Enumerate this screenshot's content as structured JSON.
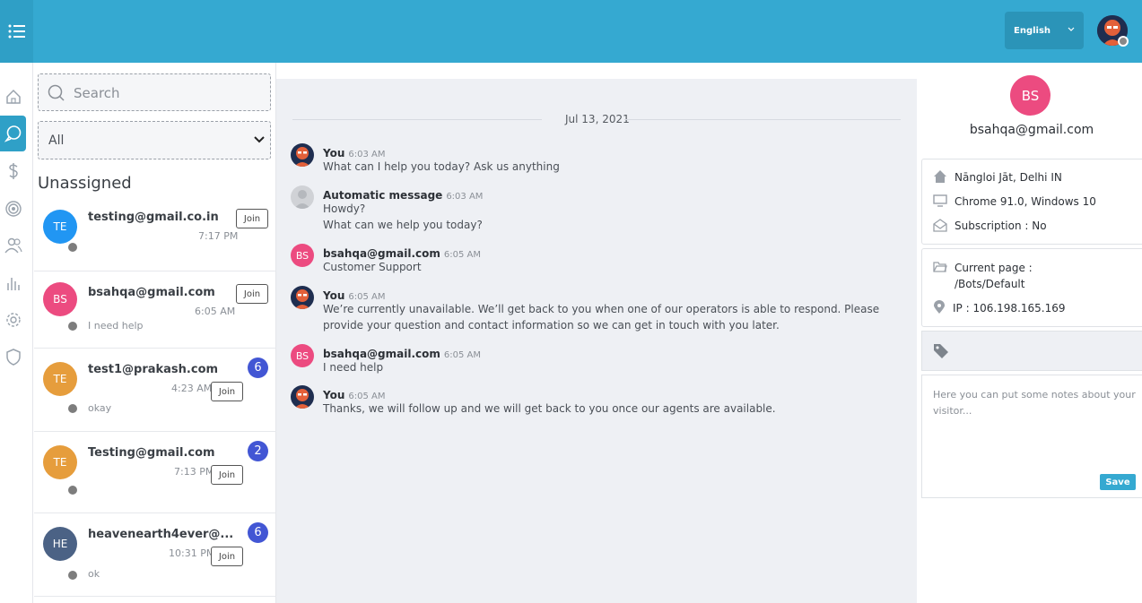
{
  "header": {
    "language": "English",
    "colors": {
      "brand": "#35a9d1",
      "accent_dark": "#2b94b8"
    }
  },
  "nav": {
    "items": [
      {
        "icon": "home-icon",
        "active": false
      },
      {
        "icon": "chat-bubble-icon",
        "active": true
      },
      {
        "icon": "dollar-icon",
        "active": false
      },
      {
        "icon": "target-icon",
        "active": false
      },
      {
        "icon": "users-icon",
        "active": false
      },
      {
        "icon": "bar-chart-icon",
        "active": false
      },
      {
        "icon": "gear-icon",
        "active": false
      },
      {
        "icon": "shield-icon",
        "active": false
      }
    ]
  },
  "sidebar": {
    "search_placeholder": "Search",
    "filter_value": "All",
    "section_title": "Unassigned",
    "conversations": [
      {
        "initials": "TE",
        "avatar_color": "#2196f3",
        "email": "testing@gmail.co.in",
        "time": "7:17 PM",
        "preview": "",
        "badge": "",
        "join": "Join"
      },
      {
        "initials": "BS",
        "avatar_color": "#ec4b80",
        "email": "bsahqa@gmail.com",
        "time": "6:05 AM",
        "preview": "I need help",
        "badge": "",
        "join": "Join"
      },
      {
        "initials": "TE",
        "avatar_color": "#e69d3c",
        "email": "test1@prakash.com",
        "time": "4:23 AM",
        "preview": "okay",
        "badge": "6",
        "join": "Join"
      },
      {
        "initials": "TE",
        "avatar_color": "#e69d3c",
        "email": "Testing@gmail.com",
        "time": "7:13 PM",
        "preview": "",
        "badge": "2",
        "join": "Join"
      },
      {
        "initials": "HE",
        "avatar_color": "#4b6285",
        "email": "heavenearth4ever@...",
        "time": "10:31 PM",
        "preview": "ok",
        "badge": "6",
        "join": "Join"
      }
    ]
  },
  "chat": {
    "date": "Jul 13, 2021",
    "messages": [
      {
        "author": "You",
        "time": "6:03 AM",
        "avatar": "operator",
        "lines": [
          "What can I help you today? Ask us anything"
        ]
      },
      {
        "author": "Automatic message",
        "time": "6:03 AM",
        "avatar": "bot",
        "lines": [
          "Howdy?",
          "What can we help you today?"
        ]
      },
      {
        "author": "bsahqa@gmail.com",
        "time": "6:05 AM",
        "avatar": "BS",
        "lines": [
          "Customer Support"
        ]
      },
      {
        "author": "You",
        "time": "6:05 AM",
        "avatar": "operator",
        "lines": [
          "We’re currently unavailable. We’ll get back to you when one of our operators is able to respond. Please provide your question and contact information so we can get in touch with you later."
        ]
      },
      {
        "author": "bsahqa@gmail.com",
        "time": "6:05 AM",
        "avatar": "BS",
        "lines": [
          "I need help"
        ]
      },
      {
        "author": "You",
        "time": "6:05 AM",
        "avatar": "operator",
        "lines": [
          "Thanks, we will follow up and we will get back to you once our agents are available."
        ]
      }
    ]
  },
  "visitor": {
    "initials": "BS",
    "email": "bsahqa@gmail.com",
    "location": "Nāngloi Jāt, Delhi IN",
    "browser": "Chrome 91.0, Windows 10",
    "subscription": "Subscription :  No",
    "current_page_label": "Current page :",
    "current_page": "/Bots/Default",
    "ip": "IP : 106.198.165.169",
    "notes_placeholder": "Here you can put some notes about your visitor...",
    "save_label": "Save"
  }
}
